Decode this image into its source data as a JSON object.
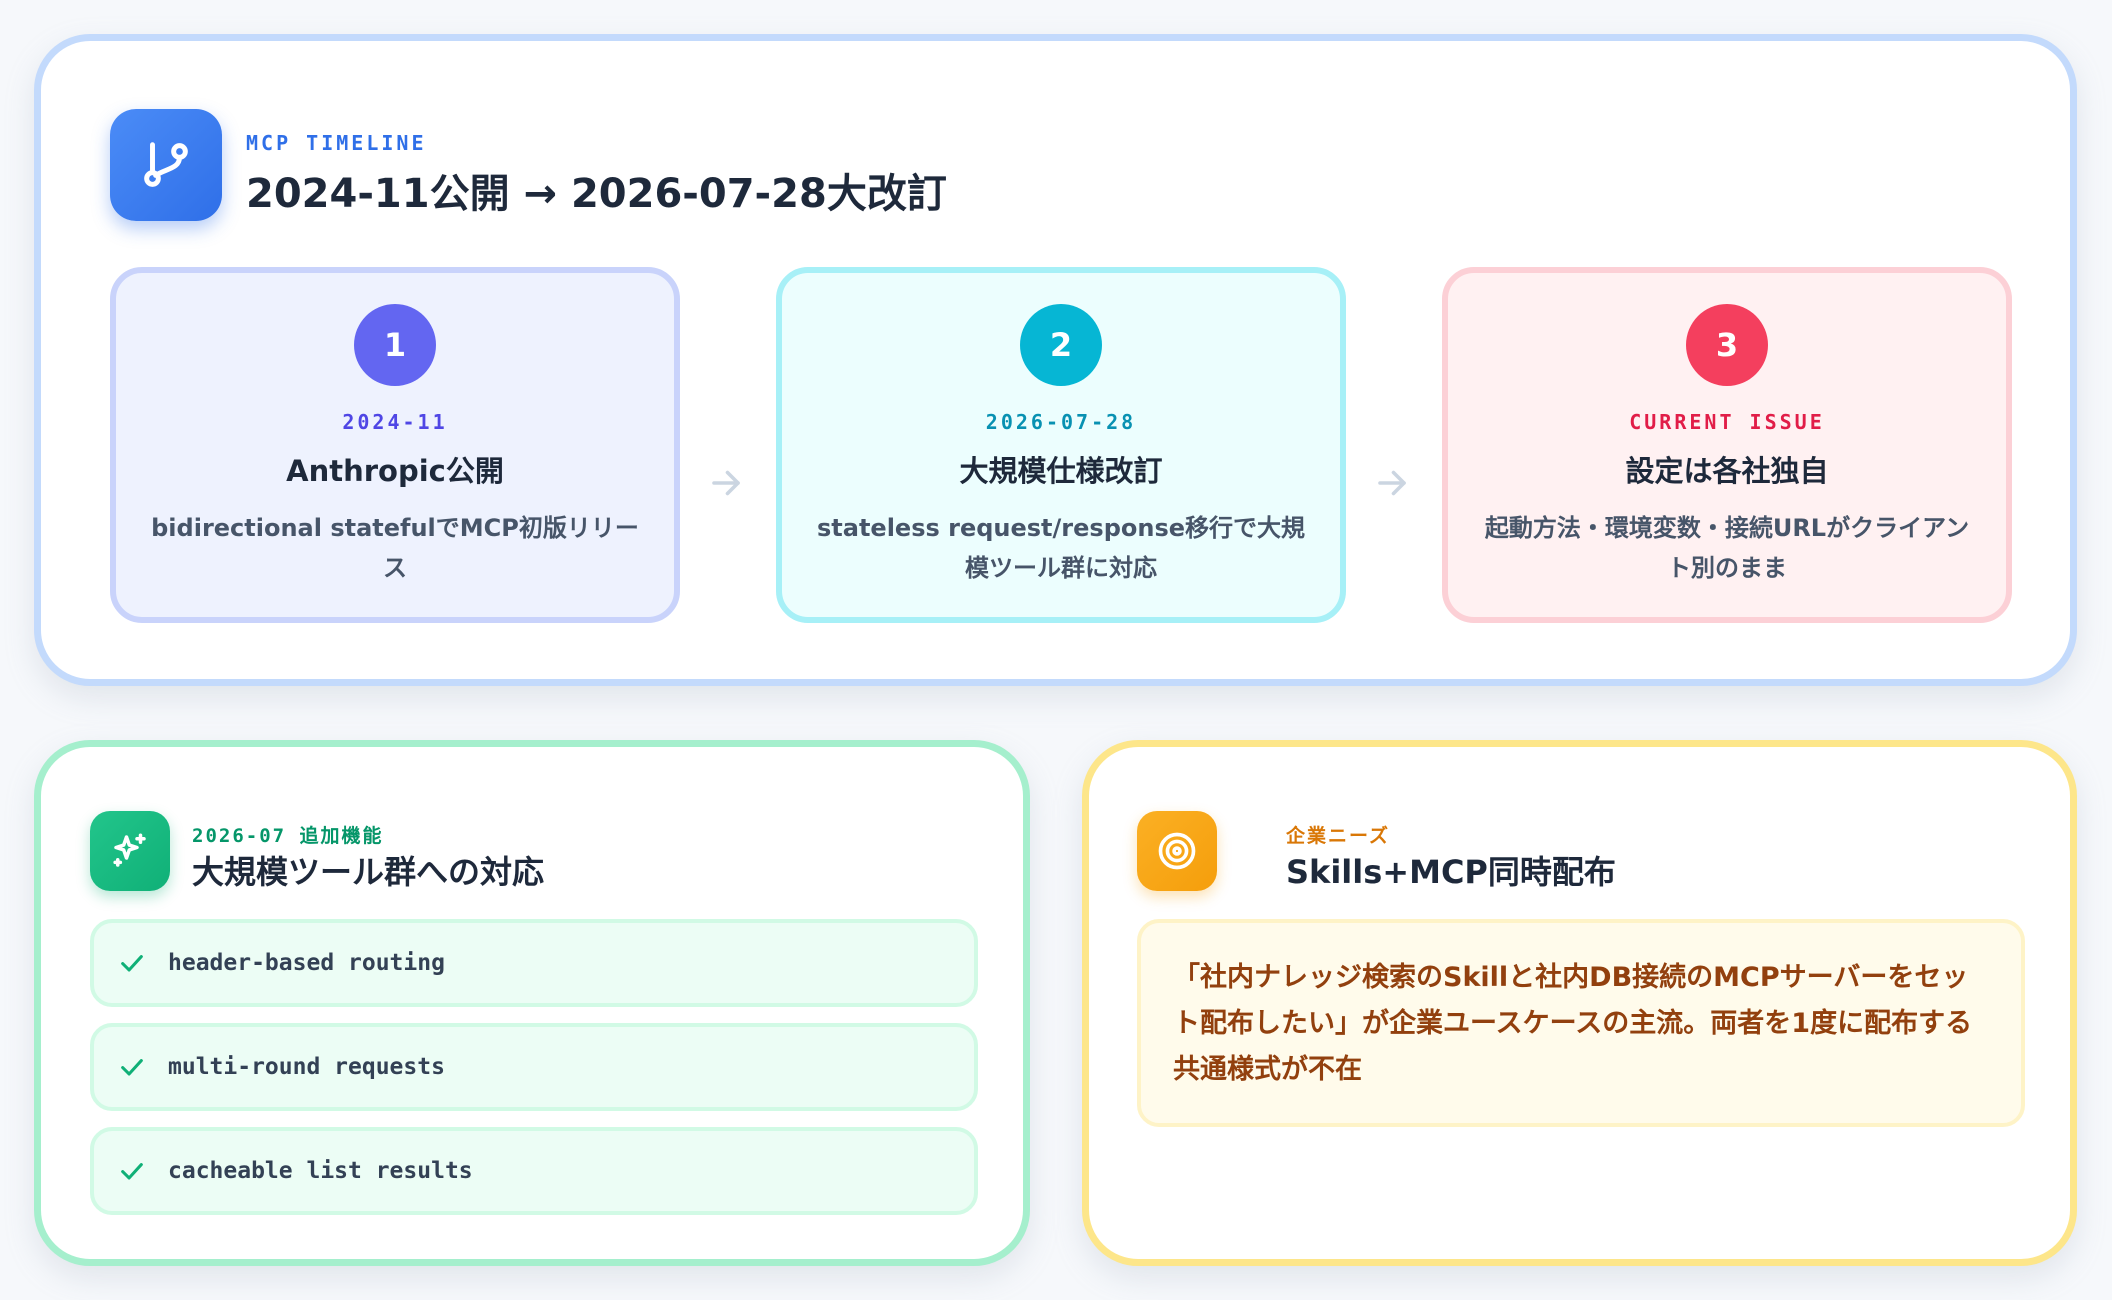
{
  "timeline": {
    "eyebrow": "MCP TIMELINE",
    "title": "2024-11公開 → 2026-07-28大改訂",
    "icon": "git-branch-icon",
    "accent": "#2f6fe8",
    "steps": [
      {
        "number": "1",
        "tag": "2024-11",
        "title": "Anthropic公開",
        "description": "bidirectional statefulでMCP初版リリース",
        "color": "#6366f1"
      },
      {
        "number": "2",
        "tag": "2026-07-28",
        "title": "大規模仕様改訂",
        "description": "stateless request/response移行で大規模ツール群に対応",
        "color": "#06b6d4"
      },
      {
        "number": "3",
        "tag": "CURRENT ISSUE",
        "title": "設定は各社独自",
        "description": "起動方法・環境変数・接続URLがクライアント別のまま",
        "color": "#f43f5e"
      }
    ]
  },
  "features": {
    "eyebrow": "2026-07 追加機能",
    "title": "大規模ツール群への対応",
    "icon": "sparkles-icon",
    "accent": "#10b077",
    "items": [
      "header-based routing",
      "multi-round requests",
      "cacheable list results"
    ]
  },
  "needs": {
    "eyebrow": "企業ニーズ",
    "title": "Skills+MCP同時配布",
    "icon": "target-icon",
    "accent": "#f59e0b",
    "quote": "「社内ナレッジ検索のSkillと社内DB接続のMCPサーバーをセット配布したい」が企業ユースケースの主流。両者を1度に配布する共通様式が不在"
  }
}
